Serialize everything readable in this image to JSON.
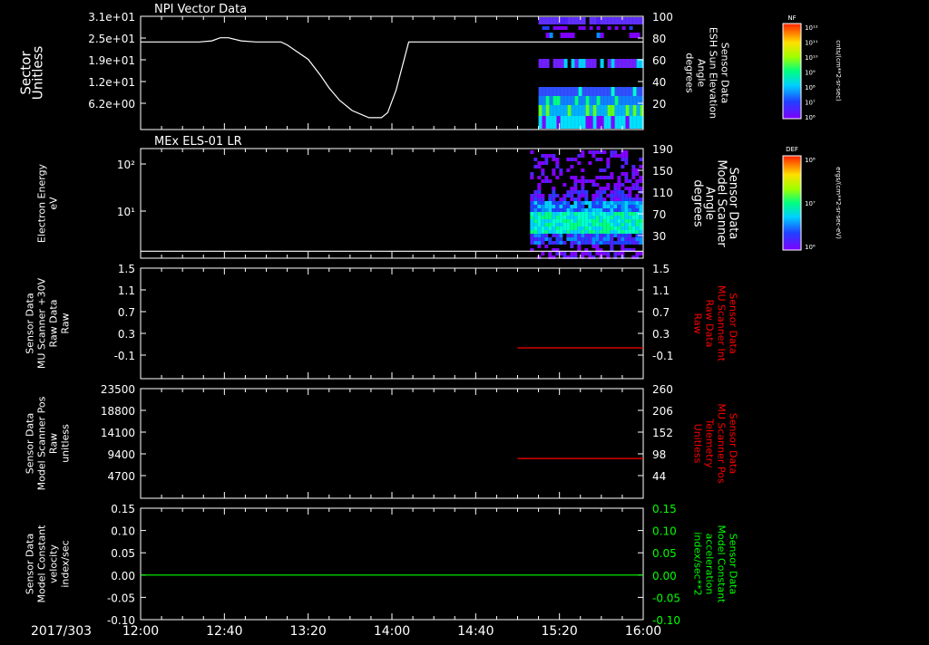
{
  "time_axis": {
    "date_label": "2017/303",
    "tick_labels": [
      "12:00",
      "12:40",
      "13:20",
      "14:00",
      "14:40",
      "15:20",
      "16:00"
    ],
    "range_minutes": [
      720,
      960
    ]
  },
  "colors": {
    "background": "#000000",
    "foreground": "#ffffff",
    "red_trace": "#ff0000",
    "green_trace": "#00ff00"
  },
  "colorbars": [
    {
      "label": "NF",
      "units": "cnts/(cm**2-sr-sec)",
      "ticks": [
        "10¹²",
        "10¹¹",
        "10¹⁰",
        "10⁹",
        "10⁸",
        "10⁷",
        "10⁶"
      ]
    },
    {
      "label": "DEF",
      "units": "ergs/(cm**2-sr-sec-eV)",
      "ticks": [
        "10⁸",
        "10⁷",
        "10⁶"
      ]
    }
  ],
  "chart_data": [
    {
      "type": "line",
      "title": "NPI Vector Data",
      "ylabel_left": [
        "Sector",
        "Unitless"
      ],
      "ylabel_right": [
        "Sensor Data",
        "ESH Sun Elevation",
        "Angle",
        "degrees"
      ],
      "left_ticks": [
        "3.1e+01",
        "2.5e+01",
        "1.9e+01",
        "1.2e+01",
        "6.2e+00"
      ],
      "right_ticks": [
        "100",
        "80",
        "60",
        "40",
        "20"
      ],
      "right_ylim": [
        0,
        100
      ],
      "series": [
        {
          "x": [
            720,
            748,
            754,
            758,
            762,
            768,
            775,
            787,
            790,
            800,
            806,
            810,
            815,
            821,
            829,
            835,
            838,
            842,
            848,
            960
          ],
          "y": [
            75,
            75,
            76,
            79,
            79,
            76,
            75,
            75,
            72,
            58,
            42,
            30,
            18,
            8,
            1,
            1,
            6,
            28,
            75,
            75
          ]
        }
      ],
      "spectrogram": {
        "t_start": 910,
        "t_end": 960,
        "levels": [
          "NF"
        ]
      }
    },
    {
      "type": "line",
      "title": "MEx ELS-01 LR",
      "ylabel_left": [
        "Electron Energy",
        "eV"
      ],
      "ylabel_right": [
        "Sensor Data",
        "Model Scanner",
        "Angle",
        "degrees"
      ],
      "left_ticks": [
        "10²",
        "10¹"
      ],
      "right_ticks": [
        "190",
        "150",
        "110",
        "70",
        "30"
      ],
      "right_ylim": [
        0,
        190
      ],
      "series": [
        {
          "x": [
            720,
            960
          ],
          "y": [
            9,
            9
          ]
        }
      ],
      "spectrogram": {
        "t_start": 906,
        "t_end": 960,
        "levels": [
          "DEF"
        ]
      }
    },
    {
      "type": "line",
      "ylabel_left": [
        "Sensor Data",
        "MU Scanner +30V",
        "Raw Data",
        "Raw"
      ],
      "ylabel_right": [
        "Sensor Data",
        "MU Scanner Int",
        "Raw Data",
        "Raw"
      ],
      "left_ticks": [
        "1.5",
        "1.1",
        "0.7",
        "0.3",
        "-0.1"
      ],
      "right_ticks": [
        "1.5",
        "1.1",
        "0.7",
        "0.3",
        "-0.1"
      ],
      "ylim": [
        -0.3,
        1.5
      ],
      "series": [
        {
          "x": [
            900,
            960
          ],
          "y": [
            0.0,
            0.0
          ],
          "color": "red"
        }
      ]
    },
    {
      "type": "line",
      "ylabel_left": [
        "Sensor Data",
        "Model Scanner Pos",
        "Raw",
        "unitless"
      ],
      "ylabel_right": [
        "Sensor Data",
        "MU Scanner Pos",
        "Telemetry",
        "Unitless"
      ],
      "left_ticks": [
        "23500",
        "18800",
        "14100",
        "9400",
        "4700"
      ],
      "right_ticks": [
        "260",
        "206",
        "152",
        "98",
        "44"
      ],
      "right_ylim": [
        0,
        260
      ],
      "series": [
        {
          "x": [
            900,
            960
          ],
          "y": [
            90,
            90
          ],
          "color": "red"
        }
      ]
    },
    {
      "type": "line",
      "ylabel_left": [
        "Sensor Data",
        "Model Constant",
        "velocity",
        "index/sec"
      ],
      "ylabel_right": [
        "Sensor Data",
        "Model Constant",
        "acceleration",
        "index/sec**2"
      ],
      "left_ticks": [
        "0.15",
        "0.10",
        "0.05",
        "0.00",
        "-0.05",
        "-0.10"
      ],
      "right_ticks": [
        "0.15",
        "0.10",
        "0.05",
        "0.00",
        "-0.05",
        "-0.10"
      ],
      "ylim": [
        -0.1,
        0.15
      ],
      "series": [
        {
          "x": [
            720,
            960
          ],
          "y": [
            0.0,
            0.0
          ],
          "color": "green"
        }
      ]
    }
  ]
}
